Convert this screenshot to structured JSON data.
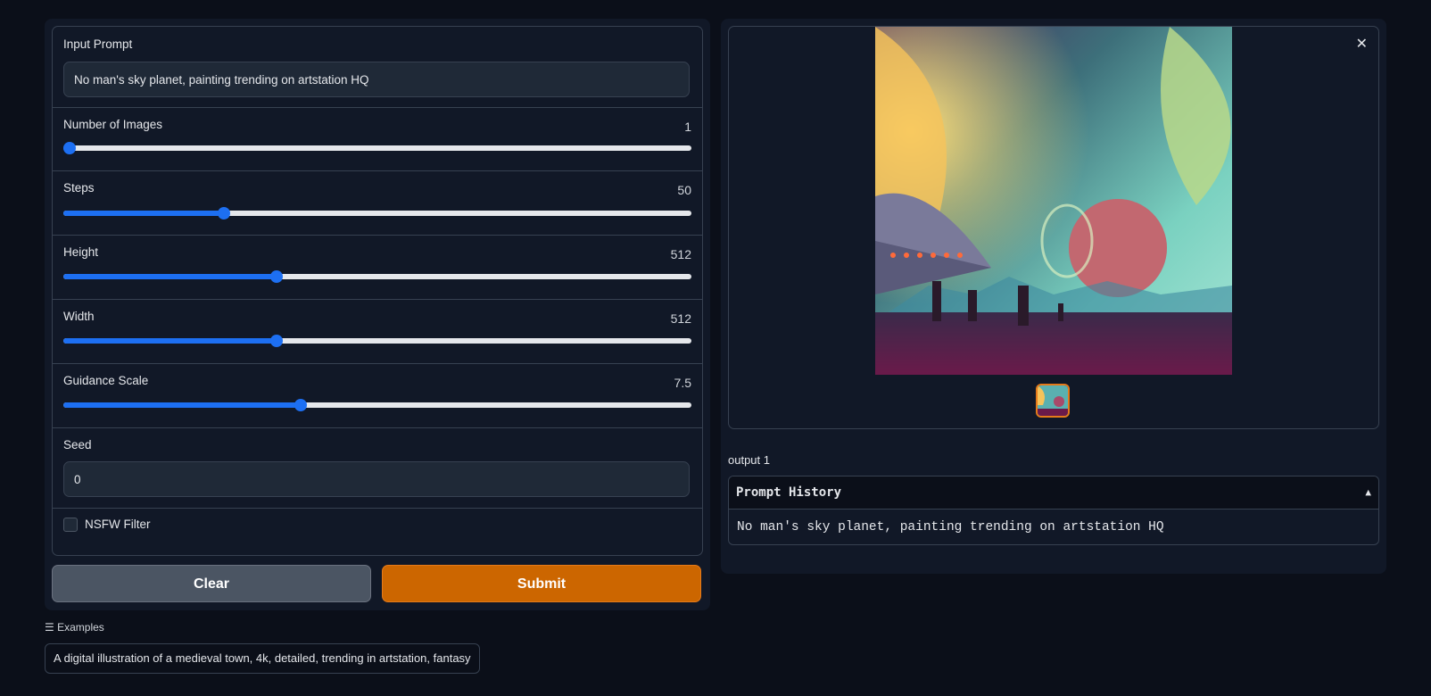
{
  "prompt": {
    "label": "Input Prompt",
    "value": "No man's sky planet, painting trending on artstation HQ"
  },
  "sliders": [
    {
      "label": "Number of Images",
      "value": "1",
      "fraction": 0.0
    },
    {
      "label": "Steps",
      "value": "50",
      "fraction": 0.25
    },
    {
      "label": "Height",
      "value": "512",
      "fraction": 0.336
    },
    {
      "label": "Width",
      "value": "512",
      "fraction": 0.336
    },
    {
      "label": "Guidance Scale",
      "value": "7.5",
      "fraction": 0.375
    }
  ],
  "seed": {
    "label": "Seed",
    "value": "0"
  },
  "nsfw": {
    "label": "NSFW Filter",
    "checked": false
  },
  "buttons": {
    "clear": "Clear",
    "submit": "Submit"
  },
  "output": {
    "label": "output 1",
    "close_icon": "✕"
  },
  "history": {
    "title": "Prompt History",
    "toggle": "▲",
    "entry": "No man's sky planet, painting trending on artstation HQ"
  },
  "examples": {
    "header": "Examples",
    "items": [
      "A digital illustration of a medieval town, 4k, detailed, trending in artstation, fantasy"
    ]
  },
  "colors": {
    "accent": "#1d6ff2",
    "submit": "#cc6600",
    "background": "#0b0f19"
  }
}
